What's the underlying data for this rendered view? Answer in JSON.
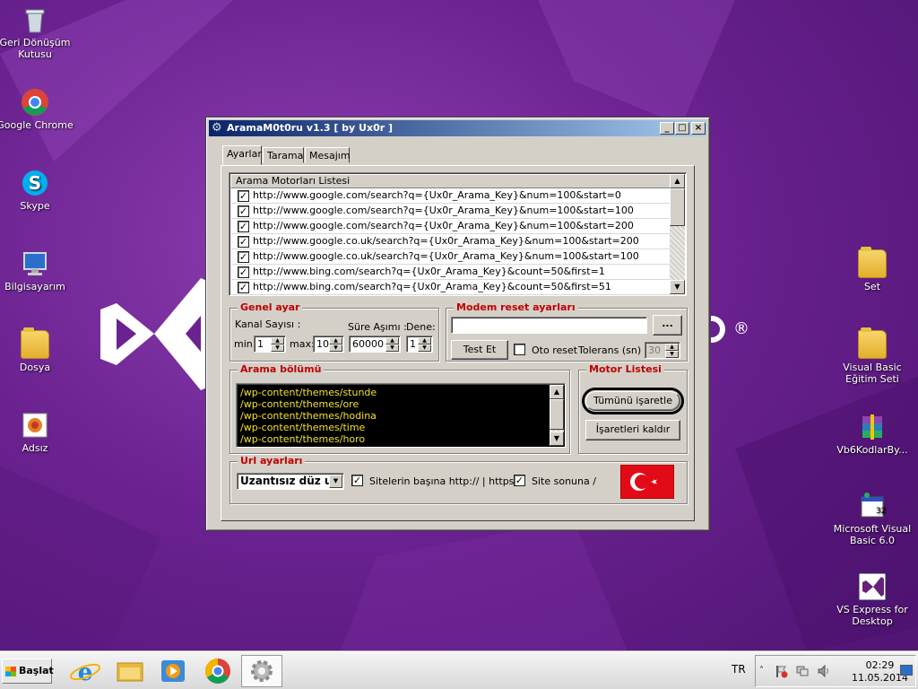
{
  "desktop": {
    "icons": [
      {
        "label": "Geri Dönüşüm Kutusu",
        "icon": "recycle-bin-icon"
      },
      {
        "label": "Google Chrome",
        "icon": "chrome-icon"
      },
      {
        "label": "Skype",
        "icon": "skype-icon"
      },
      {
        "label": "Bilgisayarım",
        "icon": "computer-icon"
      },
      {
        "label": "Dosya",
        "icon": "folder-icon"
      },
      {
        "label": "Adsız",
        "icon": "image-icon"
      },
      {
        "label": "Set",
        "icon": "folder-icon"
      },
      {
        "label": "Visual Basic Eğitim Seti",
        "icon": "folder-icon"
      },
      {
        "label": "Vb6KodlarBy...",
        "icon": "winrar-icon"
      },
      {
        "label": "Microsoft Visual Basic 6.0",
        "icon": "vb6-icon"
      },
      {
        "label": "VS Express for Desktop",
        "icon": "visual-studio-icon"
      }
    ],
    "reg_mark": "®"
  },
  "window": {
    "title": "AramaM0t0ru v1.3 [ by Ux0r ]",
    "controls": {
      "minimize": "_",
      "maximize": "□",
      "close": "×"
    },
    "tabs": [
      "Ayarlar",
      "Tarama",
      "Mesajım"
    ],
    "active_tab": "Ayarlar",
    "engine_list": {
      "header": "Arama Motorları Listesi",
      "rows": [
        {
          "checked": true,
          "url": "http://www.google.com/search?q={Ux0r_Arama_Key}&num=100&start=0"
        },
        {
          "checked": true,
          "url": "http://www.google.com/search?q={Ux0r_Arama_Key}&num=100&start=100"
        },
        {
          "checked": true,
          "url": "http://www.google.com/search?q={Ux0r_Arama_Key}&num=100&start=200"
        },
        {
          "checked": true,
          "url": "http://www.google.co.uk/search?q={Ux0r_Arama_Key}&num=100&start=200"
        },
        {
          "checked": true,
          "url": "http://www.google.co.uk/search?q={Ux0r_Arama_Key}&num=100&start=100"
        },
        {
          "checked": true,
          "url": "http://www.bing.com/search?q={Ux0r_Arama_Key}&count=50&first=1"
        },
        {
          "checked": true,
          "url": "http://www.bing.com/search?q={Ux0r_Arama_Key}&count=50&first=51"
        }
      ]
    },
    "general": {
      "title": "Genel ayar",
      "kanal_label": "Kanal Sayısı :",
      "sure_label": "Süre Aşımı :",
      "dene_label": "Dene:",
      "min_label": "min:",
      "max_label": "max:",
      "min_value": "1",
      "max_value": "10",
      "sure_value": "60000",
      "dene_value": "1"
    },
    "modem": {
      "title": "Modem reset ayarları",
      "path_value": "",
      "browse_label": "...",
      "test_label": "Test Et",
      "auto_reset_label": "Oto reset",
      "auto_reset_checked": false,
      "tolerance_label": "Tolerans (sn) :",
      "tolerance_value": "30"
    },
    "search": {
      "title": "Arama bölümü",
      "lines": [
        "/wp-content/themes/stunde",
        "/wp-content/themes/ore",
        "/wp-content/themes/hodina",
        "/wp-content/themes/time",
        "/wp-content/themes/horo"
      ]
    },
    "motor": {
      "title": "Motor Listesi",
      "select_all_label": "Tümünü işaretle",
      "clear_label": "İşaretleri kaldır"
    },
    "url": {
      "title": "Url ayarları",
      "mode_value": "Uzantısız düz url",
      "prefix_label": "Sitelerin başına http:// | https://",
      "prefix_checked": true,
      "suffix_label": "Site sonuna /",
      "suffix_checked": true
    },
    "colors": {
      "title_bar": "#0a246a",
      "group_title": "#c00000",
      "textarea_text": "#f2e22a",
      "flag_red": "#e30a17"
    }
  },
  "taskbar": {
    "start_label": "Başlat",
    "apps": [
      "ie-icon",
      "explorer-icon",
      "media-player-icon",
      "chrome-icon",
      "settings-gear-icon"
    ],
    "language": "TR",
    "time": "02:29",
    "date": "11.05.2014"
  }
}
